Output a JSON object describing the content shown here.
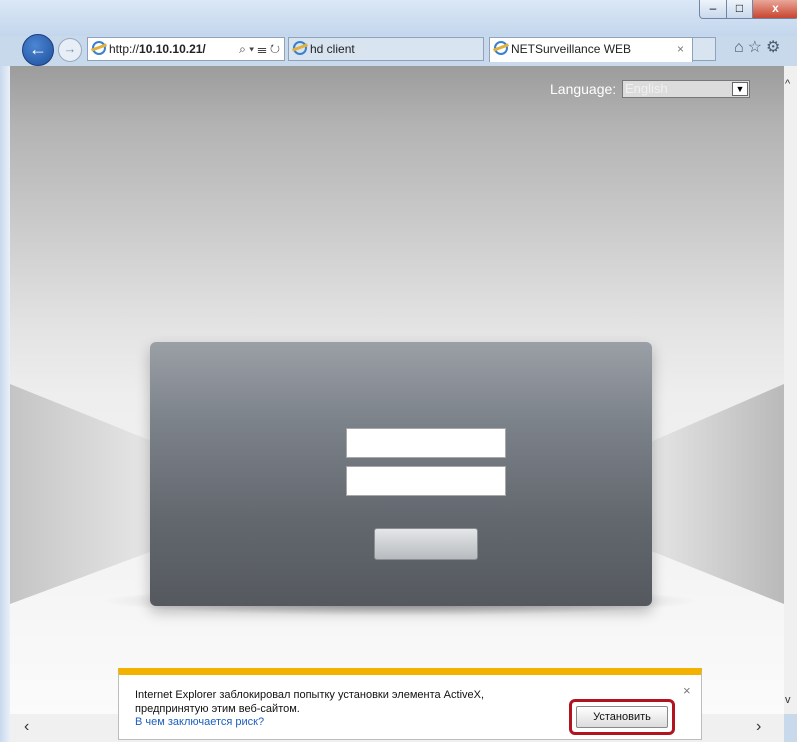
{
  "browser": {
    "address": {
      "prefix": "http://",
      "host": "10.10.10.21/",
      "tools": "⌕ ▾ ☰ ↻"
    },
    "tabs": [
      {
        "label": "hd client"
      },
      {
        "label": "NETSurveillance WEB",
        "close": "×"
      }
    ],
    "window_controls": {
      "minimize": "–",
      "maximize": "□",
      "close": "x"
    },
    "nav_icons": "⌂☆⚙"
  },
  "page": {
    "language_label": "Language:",
    "language_value": "English",
    "login": {
      "username": "",
      "password": ""
    }
  },
  "notification": {
    "message": "Internet Explorer заблокировал попытку установки элемента ActiveX, предпринятую этим веб-сайтом.",
    "risk_link": "В чем заключается риск?",
    "install_button": "Установить",
    "close": "×"
  },
  "colors": {
    "accent": "#f3b200",
    "highlight_border": "#b2141f",
    "link": "#1a5fbf"
  }
}
